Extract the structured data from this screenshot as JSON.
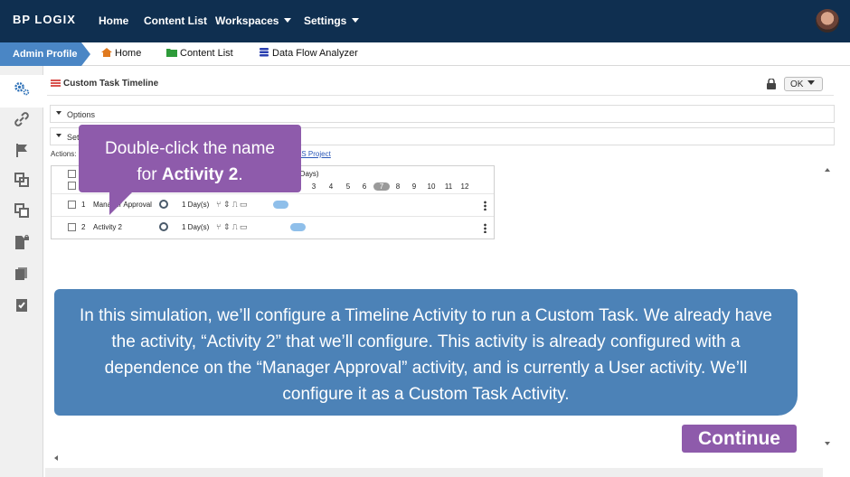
{
  "topnav": {
    "logo": "BP LOGIX",
    "items": [
      {
        "label": "Home"
      },
      {
        "label": "Content List"
      },
      {
        "label": "Workspaces"
      },
      {
        "label": "Settings"
      }
    ]
  },
  "breadcrumb": {
    "profile": "Admin Profile",
    "items": [
      {
        "label": "Home",
        "icon": "home-icon"
      },
      {
        "label": "Content List",
        "icon": "folder-icon"
      },
      {
        "label": "Data Flow Analyzer",
        "icon": "database-icon"
      }
    ]
  },
  "sidebar": {
    "icons": [
      "gears-icon",
      "link-icon",
      "flag-icon",
      "copy-icon",
      "duplicate-icon",
      "locked-document-icon",
      "pages-icon",
      "checklist-icon"
    ]
  },
  "panel": {
    "title": "Custom Task Timeline",
    "ok_label": "OK"
  },
  "sections": {
    "options": "Options",
    "settings": "Set"
  },
  "actions": {
    "label": "Actions:",
    "link": "MS Project"
  },
  "timeline": {
    "days_label": "(Days)",
    "days": [
      "3",
      "4",
      "5",
      "6",
      "7",
      "8",
      "9",
      "10",
      "11",
      "12"
    ],
    "today": "7",
    "rows": [
      {
        "num": "1",
        "name": "Manager Approval",
        "duration": "1 Day(s)"
      },
      {
        "num": "2",
        "name": "Activity 2",
        "duration": "1 Day(s)"
      }
    ]
  },
  "callout": {
    "line1": "Double-click the name",
    "line2_prefix": "for ",
    "line2_bold": "Activity 2",
    "line2_suffix": "."
  },
  "info": {
    "text": "In this simulation, we’ll configure a Timeline Activity to run a Custom Task. We already have the activity, “Activity 2” that we’ll configure. This activity is already configured with a dependence on the “Manager Approval” activity, and is currently a User activity. We’ll configure it as a Custom Task Activity."
  },
  "continue_label": "Continue",
  "colors": {
    "nav_bg": "#0f2f50",
    "accent_blue": "#4a86c5",
    "callout_purple": "#8e5bab",
    "info_blue": "#4c82b7",
    "timeline_bar": "#8fbfea"
  }
}
